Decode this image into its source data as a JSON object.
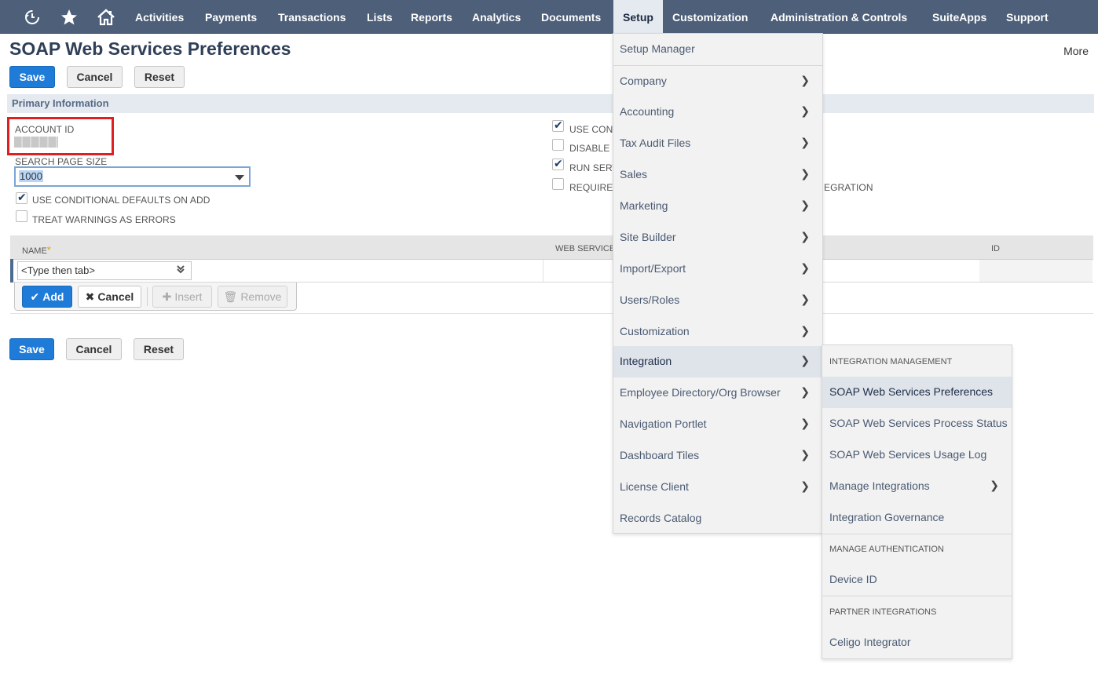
{
  "nav": {
    "items": [
      "Activities",
      "Payments",
      "Transactions",
      "Lists",
      "Reports",
      "Analytics",
      "Documents",
      "Setup",
      "Customization",
      "Administration & Controls",
      "SuiteApps",
      "Support"
    ],
    "active": "Setup",
    "icons": [
      "recent-records-icon",
      "favorites-star-icon",
      "home-icon"
    ]
  },
  "page": {
    "title": "SOAP Web Services Preferences",
    "more": "More"
  },
  "buttons": {
    "save": "Save",
    "cancel": "Cancel",
    "reset": "Reset"
  },
  "primary_info": {
    "section_title": "Primary Information",
    "account_id_label": "ACCOUNT ID",
    "search_page_size_label": "SEARCH PAGE SIZE",
    "search_page_size_value": "1000",
    "left_checkboxes": [
      {
        "label": "USE CONDITIONAL DEFAULTS ON ADD",
        "checked": true
      },
      {
        "label": "TREAT WARNINGS AS ERRORS",
        "checked": false
      }
    ],
    "right_checkboxes": [
      {
        "label": "USE COND",
        "checked": true
      },
      {
        "label": "DISABLE M",
        "checked": false
      },
      {
        "label": "RUN SERV",
        "checked": true
      },
      {
        "label": "REQUIRE A",
        "checked": false
      }
    ],
    "hidden_label_tail": "EGRATION"
  },
  "sublist": {
    "columns": {
      "name": "NAME",
      "required_mark": "*",
      "web_services": "WEB SERVICES",
      "id": "ID"
    },
    "row_placeholder": "<Type then tab>",
    "actions": {
      "add": "Add",
      "cancel": "Cancel",
      "insert": "Insert",
      "remove": "Remove"
    }
  },
  "setup_menu": {
    "items": [
      {
        "label": "Setup Manager",
        "submenu": false
      },
      {
        "label": "Company",
        "submenu": true
      },
      {
        "label": "Accounting",
        "submenu": true
      },
      {
        "label": "Tax Audit Files",
        "submenu": true
      },
      {
        "label": "Sales",
        "submenu": true
      },
      {
        "label": "Marketing",
        "submenu": true
      },
      {
        "label": "Site Builder",
        "submenu": true
      },
      {
        "label": "Import/Export",
        "submenu": true
      },
      {
        "label": "Users/Roles",
        "submenu": true
      },
      {
        "label": "Customization",
        "submenu": true
      },
      {
        "label": "Integration",
        "submenu": true,
        "highlighted": true
      },
      {
        "label": "Employee Directory/Org Browser",
        "submenu": true
      },
      {
        "label": "Navigation Portlet",
        "submenu": true
      },
      {
        "label": "Dashboard Tiles",
        "submenu": true
      },
      {
        "label": "License Client",
        "submenu": true
      },
      {
        "label": "Records Catalog",
        "submenu": false
      }
    ]
  },
  "integration_menu": {
    "sections": [
      {
        "header": "INTEGRATION MANAGEMENT",
        "items": [
          {
            "label": "SOAP Web Services Preferences",
            "highlighted": true
          },
          {
            "label": "SOAP Web Services Process Status"
          },
          {
            "label": "SOAP Web Services Usage Log"
          },
          {
            "label": "Manage Integrations",
            "submenu": true
          },
          {
            "label": "Integration Governance"
          }
        ]
      },
      {
        "header": "MANAGE AUTHENTICATION",
        "items": [
          {
            "label": "Device ID"
          }
        ]
      },
      {
        "header": "PARTNER INTEGRATIONS",
        "items": [
          {
            "label": "Celigo Integrator"
          }
        ]
      }
    ]
  },
  "colors": {
    "nav_bg": "#4d5f79",
    "primary_button": "#1f7bd8",
    "section_bar": "#e5eaf1",
    "highlight_box": "#e02020",
    "menu_bg": "#f2f2f2",
    "menu_highlight": "#dfe3ea"
  }
}
